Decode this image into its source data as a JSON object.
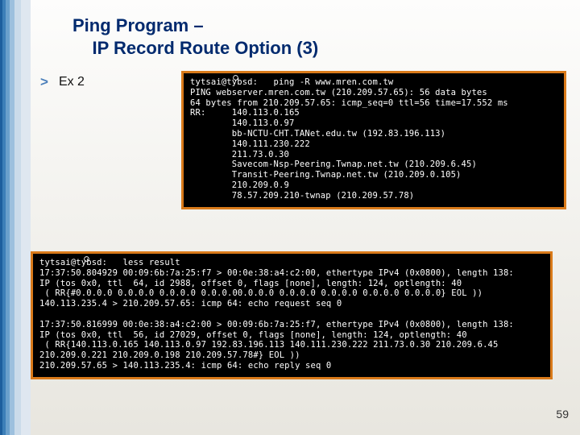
{
  "title_line1": "Ping Program –",
  "title_line2": "IP Record Route Option (3)",
  "bullet": "Ex 2",
  "term_top": "tytsai@tybsd:   ping -R www.mren.com.tw\nPING webserver.mren.com.tw (210.209.57.65): 56 data bytes\n64 bytes from 210.209.57.65: icmp_seq=0 ttl=56 time=17.552 ms\nRR:     140.113.0.165\n        140.113.0.97\n        bb-NCTU-CHT.TANet.edu.tw (192.83.196.113)\n        140.111.230.222\n        211.73.0.30\n        Savecom-Nsp-Peering.Twnap.net.tw (210.209.6.45)\n        Transit-Peering.Twnap.net.tw (210.209.0.105)\n        210.209.0.9\n        78.57.209.210-twnap (210.209.57.78)",
  "term_bottom": "tytsai@tybsd:   less result\n17:37:50.804929 00:09:6b:7a:25:f7 > 00:0e:38:a4:c2:00, ethertype IPv4 (0x0800), length 138:\nIP (tos 0x0, ttl  64, id 2988, offset 0, flags [none], length: 124, optlength: 40\n ( RR{#0.0.0.0 0.0.0.0 0.0.0.0 0.0.0.00.0.0.0 0.0.0.0 0.0.0.0 0.0.0.0 0.0.0.0} EOL ))\n140.113.235.4 > 210.209.57.65: icmp 64: echo request seq 0\n\n17:37:50.816999 00:0e:38:a4:c2:00 > 00:09:6b:7a:25:f7, ethertype IPv4 (0x0800), length 138:\nIP (tos 0x0, ttl  56, id 27029, offset 0, flags [none], length: 124, optlength: 40\n ( RR{140.113.0.165 140.113.0.97 192.83.196.113 140.111.230.222 211.73.0.30 210.209.6.45\n210.209.0.221 210.209.0.198 210.209.57.78#} EOL ))\n210.209.57.65 > 140.113.235.4: icmp 64: echo reply seq 0",
  "page_number": "59"
}
